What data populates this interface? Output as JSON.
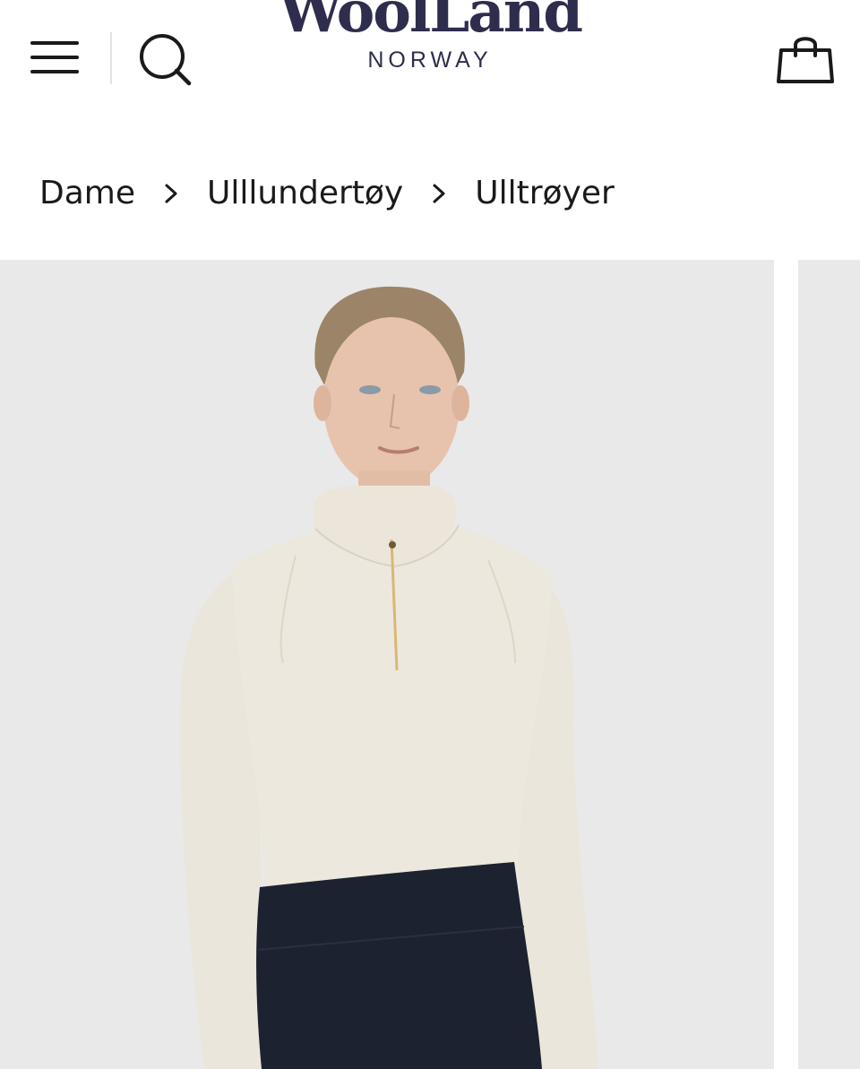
{
  "brand": {
    "name": "WoolLand",
    "country": "NORWAY"
  },
  "header": {
    "menu_icon": "hamburger-menu-icon",
    "search_icon": "search-icon",
    "cart_icon": "shopping-bag-icon"
  },
  "breadcrumb": {
    "items": [
      "Dame",
      "Ulllundertøy",
      "Ulltrøyer"
    ],
    "separator_icon": "chevron-right-icon"
  },
  "product_image": {
    "alt": "Ulltrøye"
  },
  "colors": {
    "brand": "#2e2d4d",
    "image_background": "#e9e9e9",
    "garment": "#ece7dc",
    "zipper": "#d8b877",
    "pants": "#1d2230"
  }
}
